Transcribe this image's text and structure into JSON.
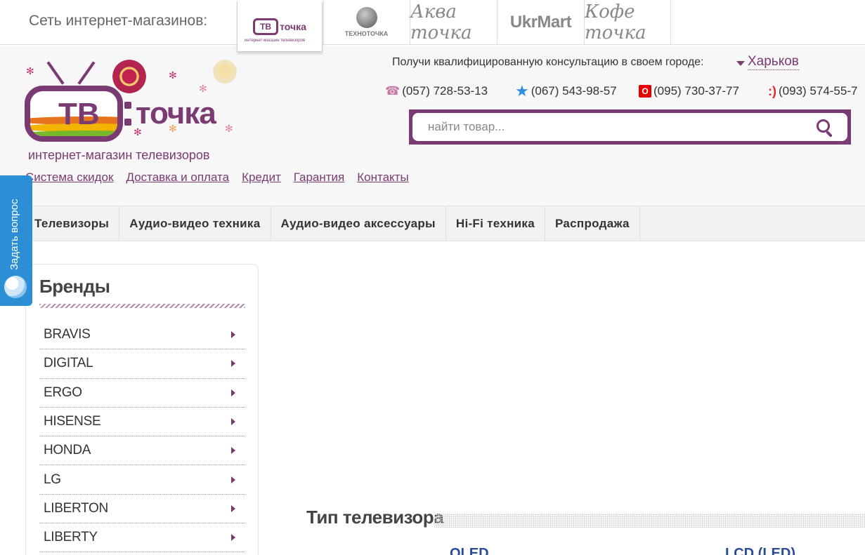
{
  "network": {
    "label": "Сеть интернет-магазинов:",
    "shops": [
      {
        "name": "ТВ точка",
        "sub": "интернет-магазин телевизоров"
      },
      {
        "name": "ТЕХНОТОЧКА"
      },
      {
        "name": "Аква точка"
      },
      {
        "name": "UkrMart"
      },
      {
        "name": "Кофе точка"
      }
    ]
  },
  "logo": {
    "tv_text": "ТВ",
    "main": "точка",
    "sub": "интернет-магазин телевизоров"
  },
  "header": {
    "consult": "Получи квалифицированную консультацию в своем городе:",
    "city": "Харьков",
    "phones": [
      {
        "icon": "kyivstar-phone-icon",
        "number": "(057) 728-53-13"
      },
      {
        "icon": "kyivstar-star-icon",
        "number": "(067) 543-98-57"
      },
      {
        "icon": "vodafone-icon",
        "number": "(095) 730-37-77"
      },
      {
        "icon": "lifecell-icon",
        "number": "(093) 574-55-7"
      }
    ],
    "search_placeholder": "найти товар...",
    "links": [
      "Система скидок",
      "Доставка и оплата",
      "Кредит",
      "Гарантия",
      "Контакты"
    ]
  },
  "nav": [
    "Телевизоры",
    "Аудио-видео техника",
    "Аудио-видео аксессуары",
    "Hi-Fi техника",
    "Распродажа"
  ],
  "ask": {
    "label": "Задать вопрос"
  },
  "brands": {
    "title": "Бренды",
    "items": [
      "BRAVIS",
      "DIGITAL",
      "ERGO",
      "HISENSE",
      "HONDA",
      "LG",
      "LIBERTON",
      "LIBERTY"
    ]
  },
  "tv_type": {
    "title": "Тип телевизора",
    "items": [
      "OLED",
      "LCD (LED)"
    ]
  },
  "colors": {
    "brand": "#7a3a72",
    "accent_blue": "#2c8fd6",
    "link_blue": "#2a4a9a"
  }
}
